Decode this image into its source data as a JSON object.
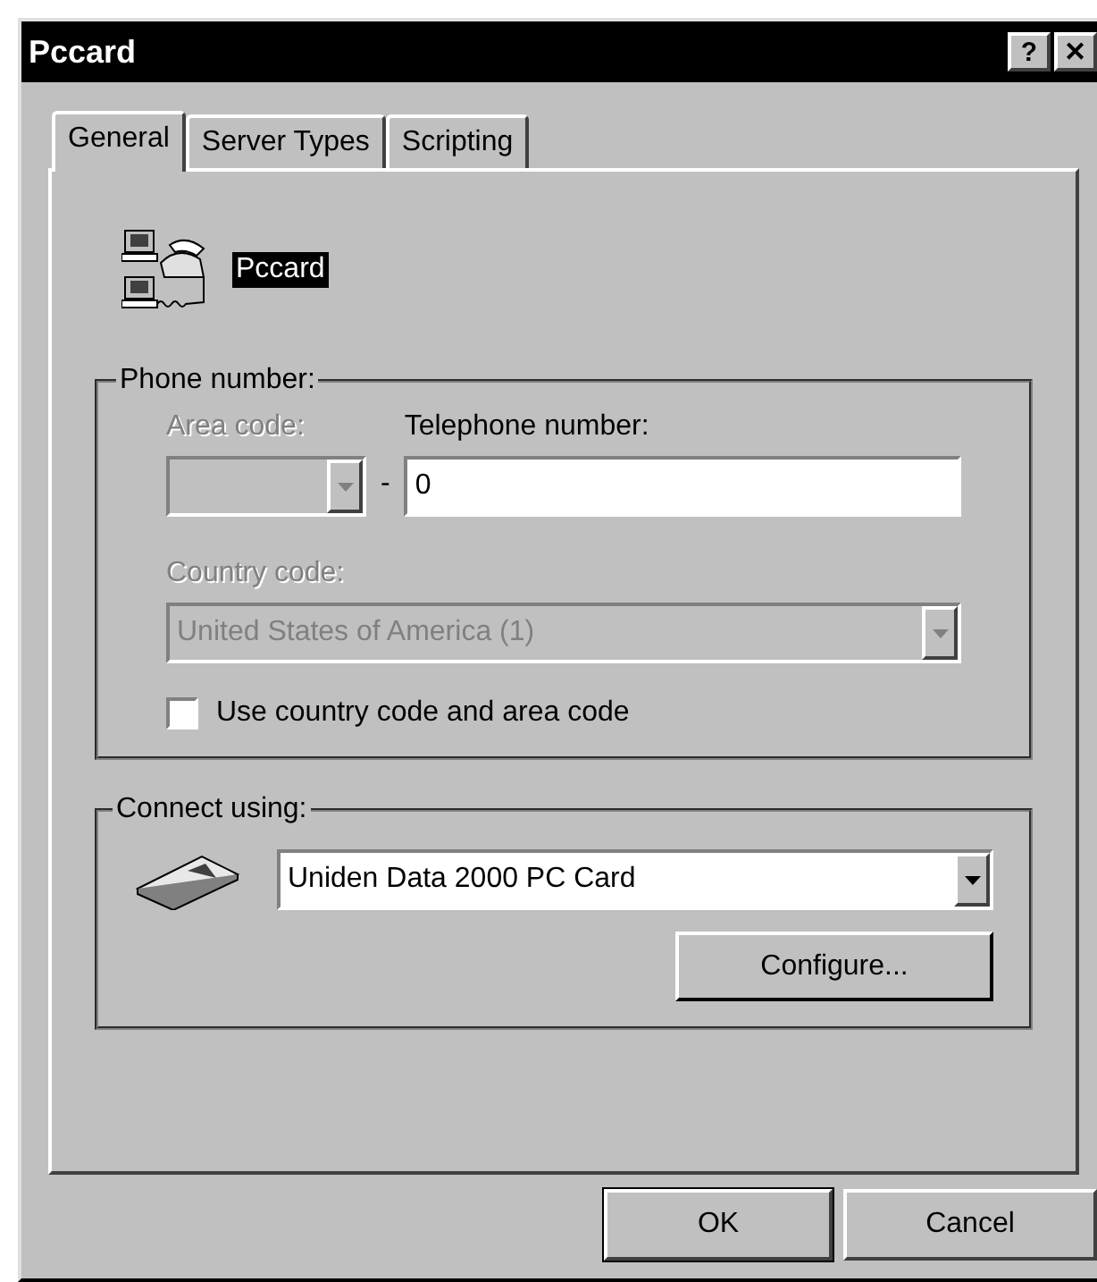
{
  "window": {
    "title": "Pccard",
    "title_buttons": [
      "?",
      "✕"
    ]
  },
  "tabs": [
    {
      "label": "General",
      "selected": true
    },
    {
      "label": "Server Types",
      "selected": false
    },
    {
      "label": "Scripting",
      "selected": false
    }
  ],
  "connection_name": "Pccard",
  "phone_group": {
    "label": "Phone number:",
    "area_code": {
      "label": "Area code:",
      "disabled": true
    },
    "separator": "-",
    "telephone": {
      "label": "Telephone number:",
      "value": "0",
      "disabled": false
    },
    "country_code": {
      "label": "Country code:",
      "value": "United States of America (1)",
      "disabled": true
    },
    "use_codes": {
      "label": "Use country code and area code",
      "checked": false
    }
  },
  "connect_group": {
    "label": "Connect using:",
    "device": "Uniden Data 2000 PC Card",
    "configure_button": "Configure..."
  },
  "buttons": [
    "OK",
    "Cancel"
  ]
}
